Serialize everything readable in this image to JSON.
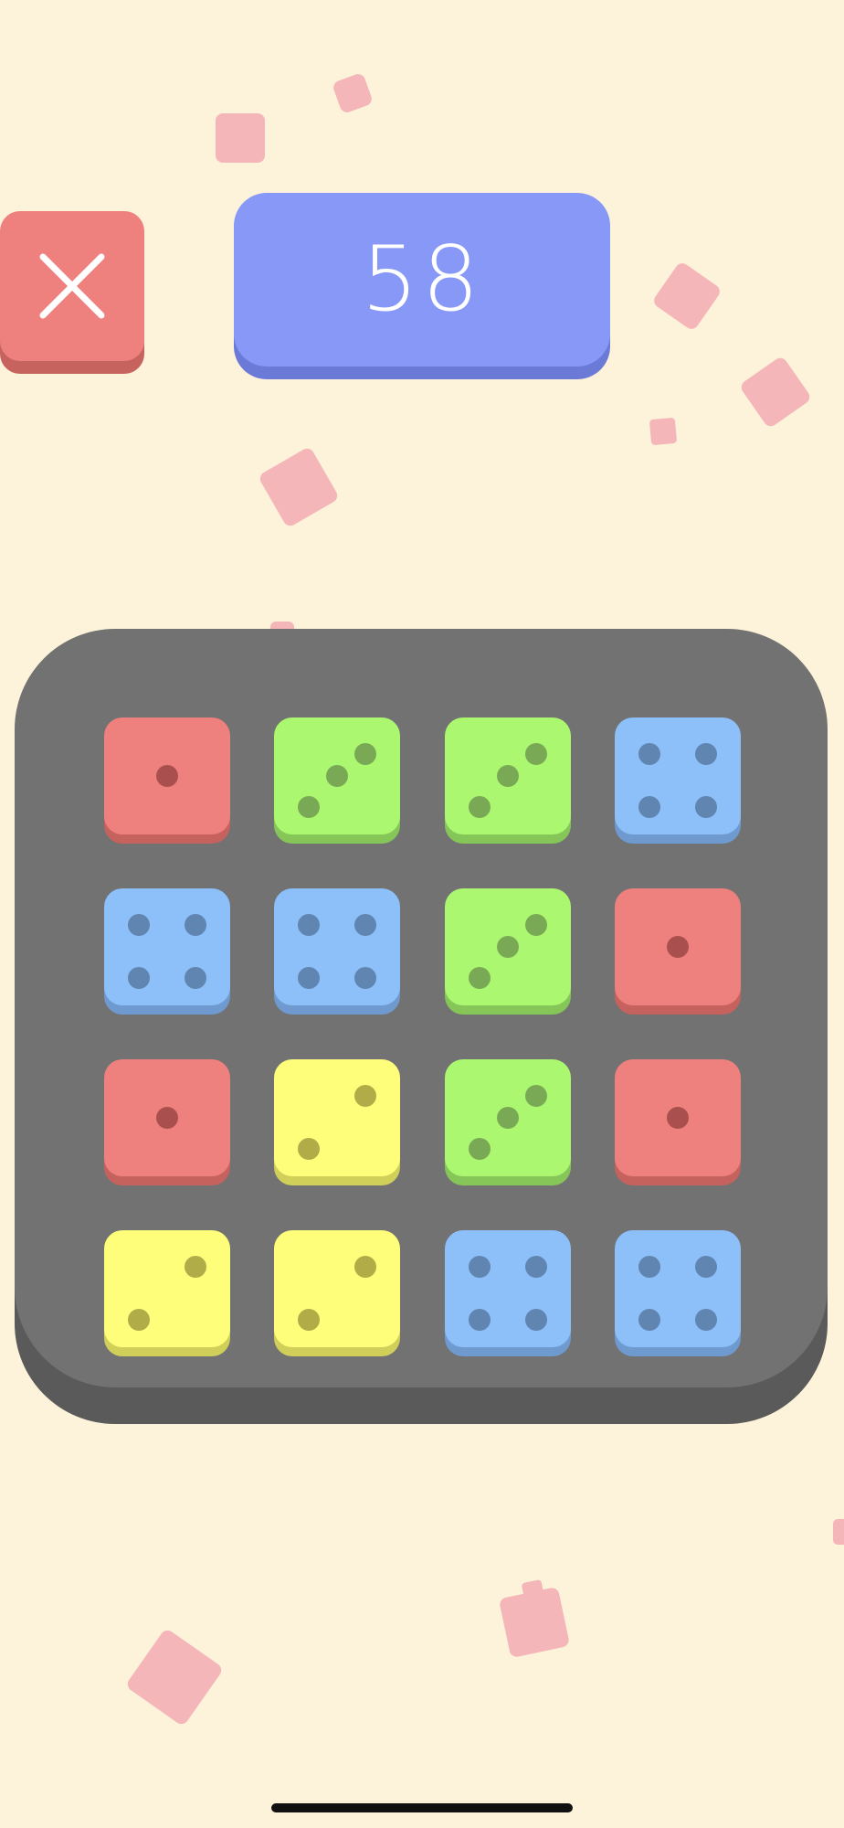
{
  "score": {
    "value": "58"
  },
  "close_button": {
    "icon": "close-icon",
    "color": "#ee807d"
  },
  "colors": {
    "background": "#fdf3da",
    "board": "#727272",
    "score_panel": "#8898f7",
    "red": "#ee807d",
    "green": "#abf870",
    "blue": "#8dbff9",
    "yellow": "#fefe7b",
    "confetti": "#f4b6b8"
  },
  "board": {
    "rows": 4,
    "cols": 4,
    "dice": [
      {
        "color": "red",
        "value": 1
      },
      {
        "color": "green",
        "value": 3
      },
      {
        "color": "green",
        "value": 3
      },
      {
        "color": "blue",
        "value": 4
      },
      {
        "color": "blue",
        "value": 4
      },
      {
        "color": "blue",
        "value": 4
      },
      {
        "color": "green",
        "value": 3
      },
      {
        "color": "red",
        "value": 1
      },
      {
        "color": "red",
        "value": 1
      },
      {
        "color": "yellow",
        "value": 2
      },
      {
        "color": "green",
        "value": 3
      },
      {
        "color": "red",
        "value": 1
      },
      {
        "color": "yellow",
        "value": 2
      },
      {
        "color": "yellow",
        "value": 2
      },
      {
        "color": "blue",
        "value": 4
      },
      {
        "color": "blue",
        "value": 4
      }
    ]
  }
}
